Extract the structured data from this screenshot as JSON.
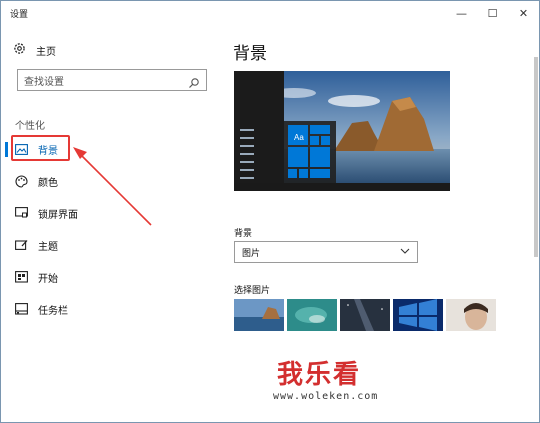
{
  "window": {
    "title": "设置",
    "minimize": "—",
    "maximize": "☐",
    "close": "✕"
  },
  "sidebar": {
    "home_label": "主页",
    "search_placeholder": "查找设置",
    "section_label": "个性化",
    "items": [
      {
        "label": "背景",
        "icon": "picture-icon",
        "active": true
      },
      {
        "label": "颜色",
        "icon": "palette-icon",
        "active": false
      },
      {
        "label": "锁屏界面",
        "icon": "lock-screen-icon",
        "active": false
      },
      {
        "label": "主题",
        "icon": "theme-icon",
        "active": false
      },
      {
        "label": "开始",
        "icon": "start-icon",
        "active": false
      },
      {
        "label": "任务栏",
        "icon": "taskbar-icon",
        "active": false
      }
    ]
  },
  "main": {
    "title": "背景",
    "preview_tile_text": "Aa",
    "background_label": "背景",
    "background_value": "图片",
    "choose_picture_label": "选择图片"
  },
  "watermark": {
    "text": "我乐看",
    "url": "www.woleken.com"
  },
  "colors": {
    "accent": "#0078d7",
    "highlight": "#e53935"
  }
}
